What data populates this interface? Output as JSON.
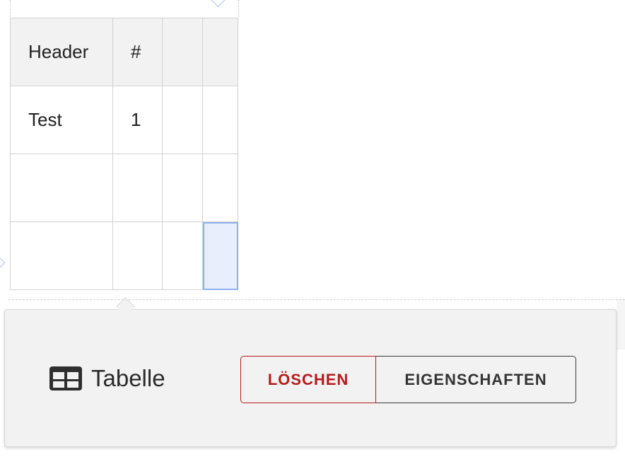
{
  "table": {
    "rows": [
      [
        "Header",
        "#",
        "",
        ""
      ],
      [
        "Test",
        "1",
        "",
        ""
      ],
      [
        "",
        "",
        "",
        ""
      ],
      [
        "",
        "",
        "",
        ""
      ]
    ]
  },
  "toolbar": {
    "widget_icon": "table-icon",
    "widget_label": "Tabelle",
    "delete_label": "LÖSCHEN",
    "properties_label": "EIGENSCHAFTEN"
  },
  "colors": {
    "delete": "#b71c1c",
    "selection": "#e8eefc",
    "selection_border": "#8fb0ee"
  }
}
